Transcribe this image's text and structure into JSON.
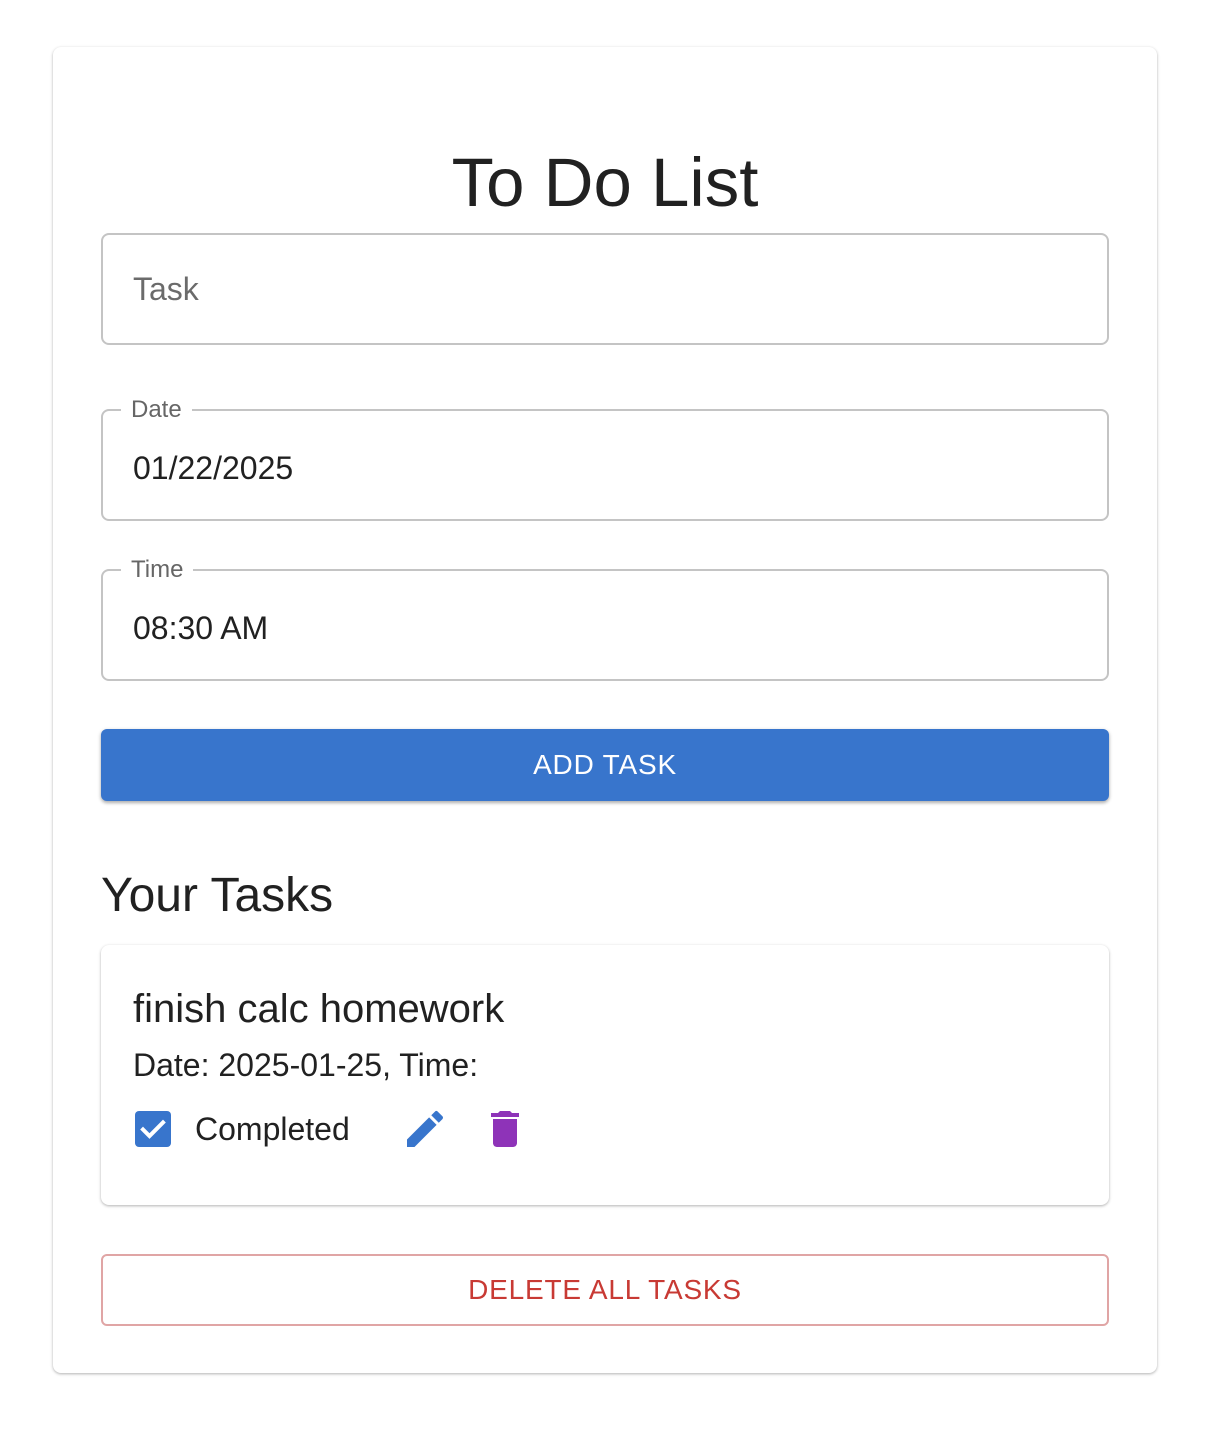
{
  "app": {
    "title": "To Do List"
  },
  "form": {
    "task_placeholder": "Task",
    "task_value": "",
    "date_label": "Date",
    "date_value": "01/22/2025",
    "time_label": "Time",
    "time_value": "08:30 AM",
    "add_button_label": "ADD TASK"
  },
  "tasks_section": {
    "title": "Your Tasks",
    "items": [
      {
        "name": "finish calc homework",
        "meta": "Date: 2025-01-25, Time:",
        "completed": true,
        "completed_label": "Completed",
        "edit_icon": "pencil-icon",
        "delete_icon": "trash-icon"
      }
    ]
  },
  "delete_all_label": "DELETE ALL TASKS",
  "colors": {
    "primary": "#3875cc",
    "delete_icon": "#8e33b8",
    "danger": "#c83a34",
    "danger_border": "#e0a5a5"
  }
}
